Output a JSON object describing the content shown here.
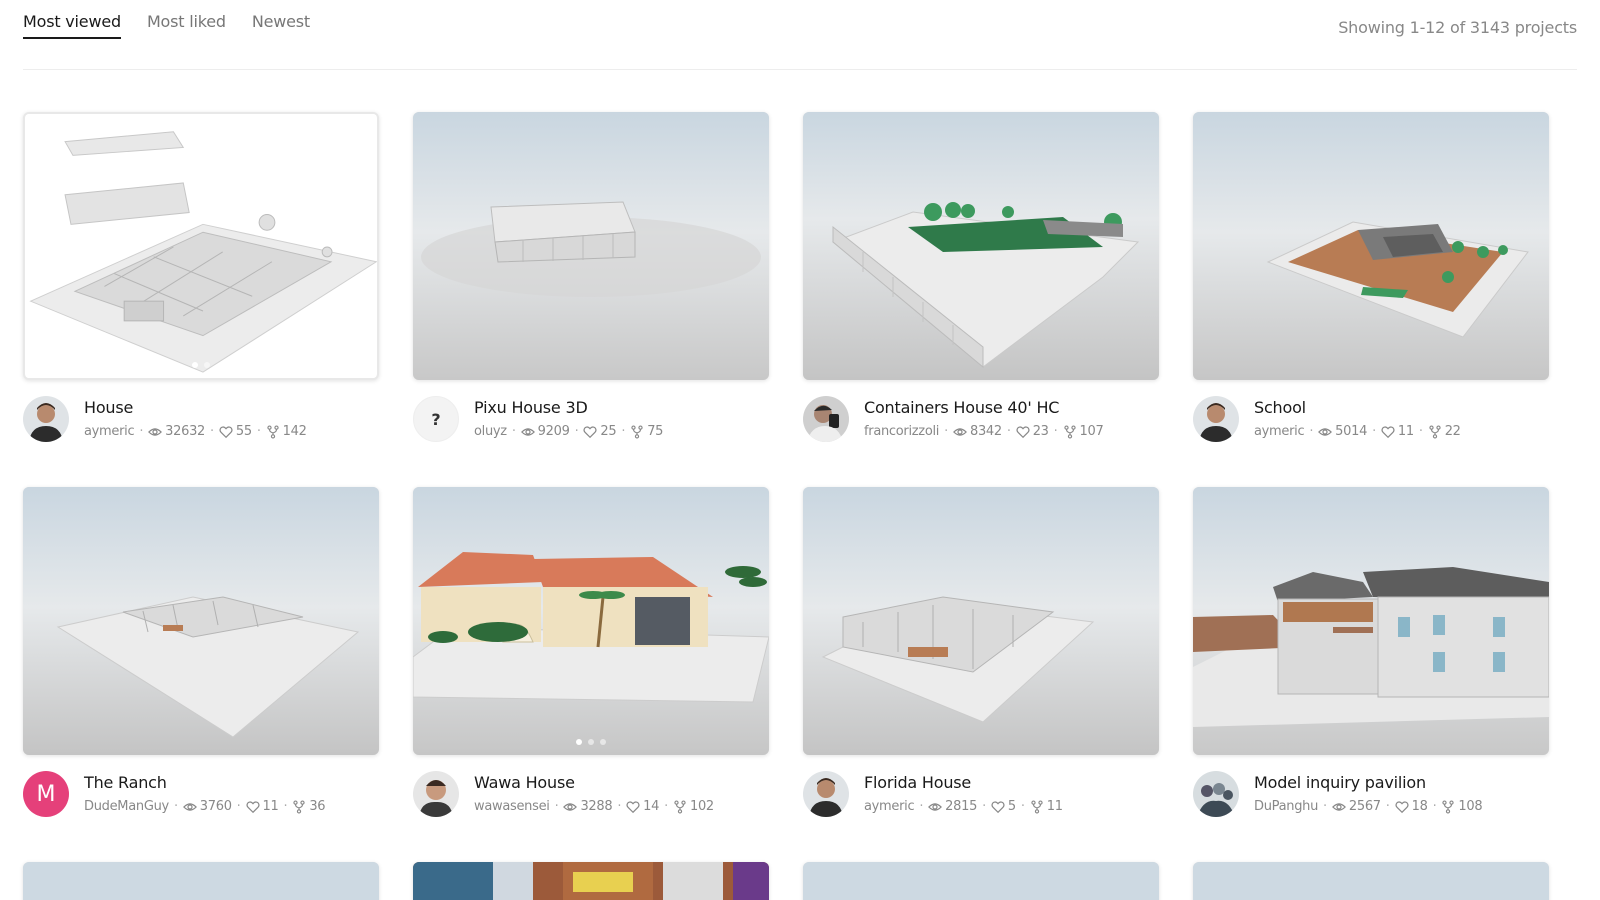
{
  "tabs": [
    {
      "label": "Most viewed"
    },
    {
      "label": "Most liked"
    },
    {
      "label": "Newest"
    }
  ],
  "showing": "Showing 1-12 of 3143 projects",
  "projects": [
    {
      "title": "House",
      "user": "aymeric",
      "views": "32632",
      "likes": "55",
      "forks": "142",
      "avatar": "photo-person",
      "image": "house-exploded"
    },
    {
      "title": "Pixu House 3D",
      "user": "oluyz",
      "views": "9209",
      "likes": "25",
      "forks": "75",
      "avatar": "?",
      "image": "box-walls"
    },
    {
      "title": "Containers House 40' HC",
      "user": "francorizzoli",
      "views": "8342",
      "likes": "23",
      "forks": "107",
      "avatar": "photo-person",
      "image": "containers"
    },
    {
      "title": "School",
      "user": "aymeric",
      "views": "5014",
      "likes": "11",
      "forks": "22",
      "avatar": "photo-person",
      "image": "school"
    },
    {
      "title": "The Ranch",
      "user": "DudeManGuy",
      "views": "3760",
      "likes": "11",
      "forks": "36",
      "avatar": "M",
      "image": "ranch"
    },
    {
      "title": "Wawa House",
      "user": "wawasensei",
      "views": "3288",
      "likes": "14",
      "forks": "102",
      "avatar": "photo-person",
      "image": "wawa"
    },
    {
      "title": "Florida House",
      "user": "aymeric",
      "views": "2815",
      "likes": "5",
      "forks": "11",
      "avatar": "photo-person",
      "image": "florida"
    },
    {
      "title": "Model inquiry pavilion",
      "user": "DuPanghu",
      "views": "2567",
      "likes": "18",
      "forks": "108",
      "avatar": "photo-crowd",
      "image": "pavilion"
    }
  ],
  "icons": {
    "views": "eye-icon",
    "likes": "heart-icon",
    "forks": "fork-icon"
  },
  "colors": {
    "accent_avatar": "#e5407a",
    "text_muted": "#888888"
  }
}
